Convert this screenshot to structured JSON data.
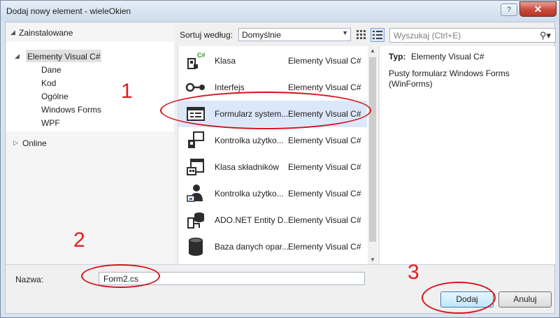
{
  "window": {
    "title": "Dodaj nowy element - wieleOkien",
    "help_glyph": "?",
    "close_glyph": "✕"
  },
  "tree": {
    "installed": "Zainstalowane",
    "root": "Elementy Visual C#",
    "children": [
      "Dane",
      "Kod",
      "Ogólne",
      "Windows Forms",
      "WPF"
    ],
    "online": "Online"
  },
  "toolbar": {
    "sort_label": "Sortuj według:",
    "sort_value": "Domyślnie",
    "search_placeholder": "Wyszukaj (Ctrl+E)"
  },
  "items": [
    {
      "name": "Klasa",
      "lang": "Elementy Visual C#",
      "icon": "class-icon",
      "badge": "C#"
    },
    {
      "name": "Interfejs",
      "lang": "Elementy Visual C#",
      "icon": "interface-icon"
    },
    {
      "name": "Formularz system...",
      "lang": "Elementy Visual C#",
      "icon": "form-icon",
      "selected": true
    },
    {
      "name": "Kontrolka użytko...",
      "lang": "Elementy Visual C#",
      "icon": "user-control-icon"
    },
    {
      "name": "Klasa składników",
      "lang": "Elementy Visual C#",
      "icon": "component-class-icon"
    },
    {
      "name": "Kontrolka użytko...",
      "lang": "Elementy Visual C#",
      "icon": "user-control-person-icon"
    },
    {
      "name": "ADO.NET Entity D...",
      "lang": "Elementy Visual C#",
      "icon": "entity-model-icon"
    },
    {
      "name": "Baza danych opar...",
      "lang": "Elementy Visual C#",
      "icon": "database-icon"
    }
  ],
  "details": {
    "type_label": "Typ:",
    "type_value": "Elementy Visual C#",
    "description": "Pusty formularz Windows Forms (WinForms)"
  },
  "bottom": {
    "name_label": "Nazwa:",
    "name_value": "Form2.cs",
    "add_label": "Dodaj",
    "cancel_label": "Anuluj"
  },
  "annotations": [
    "1",
    "2",
    "3"
  ],
  "colors": {
    "annotation": "#e31c1c",
    "selection": "#dce7fa",
    "icon_dark": "#2d2d30",
    "icon_green": "#388a34"
  }
}
